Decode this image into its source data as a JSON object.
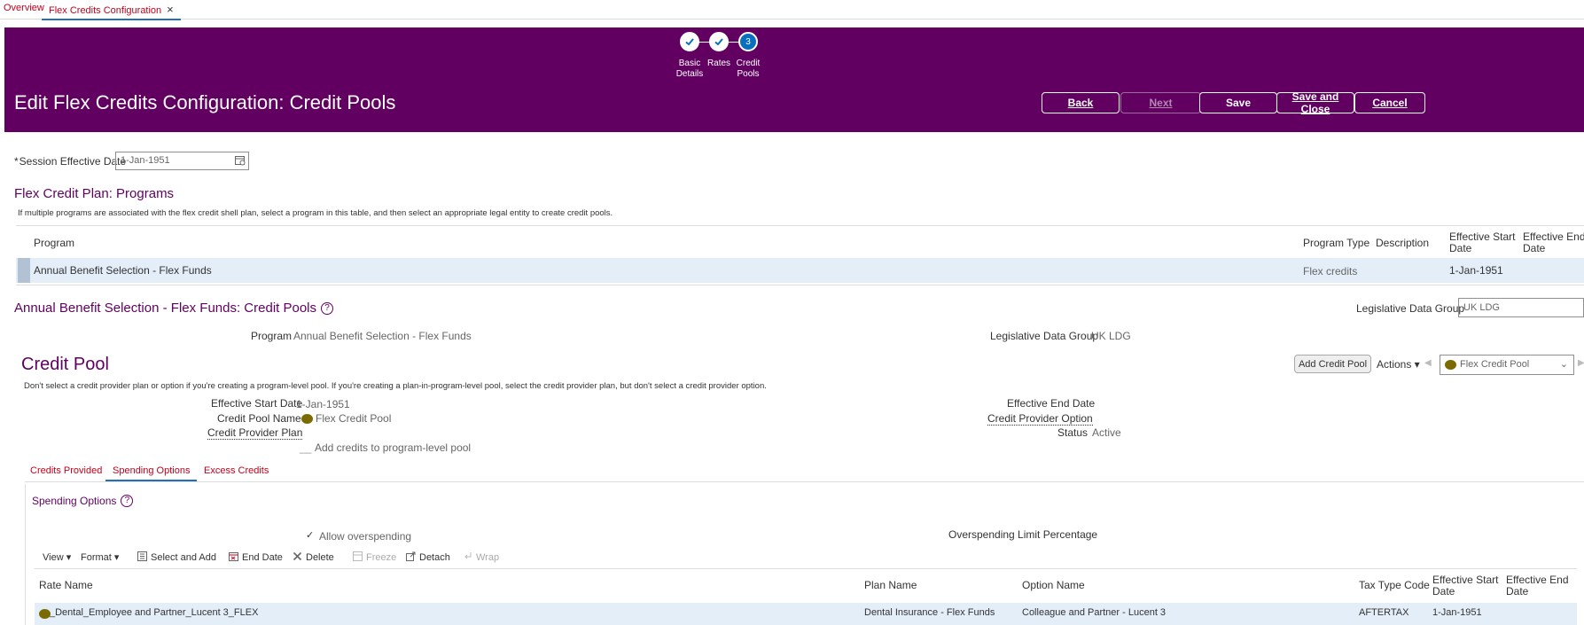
{
  "top_tabs": {
    "overview": "Overview",
    "flex": "Flex Credits Configuration",
    "close": "×"
  },
  "train": {
    "steps": [
      {
        "label": "Basic\nDetails",
        "state": "done"
      },
      {
        "label": "Rates",
        "state": "done"
      },
      {
        "label": "Credit\nPools",
        "state": "current",
        "number": "3"
      }
    ]
  },
  "header": {
    "title": "Edit Flex Credits Configuration: Credit Pools",
    "back": "Back",
    "next": "Next",
    "save": "Save",
    "save_close": "Save and Close",
    "cancel": "Cancel",
    "color": "#610061"
  },
  "session": {
    "required_mark": "*",
    "label": "Session Effective Date",
    "value": "1-Jan-1951"
  },
  "programs": {
    "title": "Flex Credit Plan: Programs",
    "instructions": "If multiple programs are associated with the flex credit shell plan, select a program in this table, and then select an appropriate legal entity to create credit pools.",
    "columns": {
      "program": "Program",
      "type": "Program Type",
      "desc": "Description",
      "start": "Effective Start Date",
      "end": "Effective End Date"
    },
    "row": {
      "program": "Annual Benefit Selection - Flex Funds",
      "type": "Flex credits",
      "desc": "",
      "start": "1-Jan-1951",
      "end": ""
    }
  },
  "pools": {
    "title": "Annual Benefit Selection - Flex Funds: Credit Pools",
    "help": "?",
    "ldg_label": "Legislative Data Group",
    "ldg_value": "UK LDG",
    "program_label": "Program",
    "program_value": "Annual Benefit Selection - Flex Funds",
    "ldg_label2": "Legislative Data Group",
    "ldg_value2": "UK LDG"
  },
  "credit_pool": {
    "title": "Credit Pool",
    "add_button": "Add Credit Pool",
    "actions": "Actions ▾",
    "selected": "Flex Credit Pool",
    "instructions": "Don't select a credit provider plan or option if you're creating a program-level pool. If you're creating a plan-in-program-level pool, select the credit provider plan, but don't select a credit provider option.",
    "start_label": "Effective Start Date",
    "start_value": "1-Jan-1951",
    "name_label": "Credit Pool Name",
    "name_value": "Flex Credit Pool",
    "provider_plan_label": "Credit Provider Plan",
    "add_credits": "Add credits to program-level pool",
    "end_label": "Effective End Date",
    "end_value": "",
    "provider_option_label": "Credit Provider Option",
    "status_label": "Status",
    "status_value": "Active"
  },
  "subtabs": {
    "provided": "Credits Provided",
    "spending": "Spending Options",
    "excess": "Excess Credits"
  },
  "spending": {
    "title": "Spending Options",
    "help": "?",
    "allow_check": "✓",
    "allow_label": "Allow overspending",
    "limit_label": "Overspending Limit Percentage",
    "toolbar": {
      "view": "View ▾",
      "format": "Format ▾",
      "select_add": "Select and Add",
      "end_date": "End Date",
      "delete": "Delete",
      "freeze": "Freeze",
      "detach": "Detach",
      "wrap": "Wrap"
    },
    "columns": {
      "rate": "Rate Name",
      "plan": "Plan Name",
      "option": "Option Name",
      "tax": "Tax Type Code",
      "start": "Effective Start Date",
      "end": "Effective End Date"
    },
    "row": {
      "rate": "_Dental_Employee and Partner_Lucent 3_FLEX",
      "plan": "Dental Insurance - Flex Funds",
      "option": "Colleague and Partner - Lucent 3",
      "tax": "AFTERTAX",
      "start": "1-Jan-1951",
      "end": ""
    }
  }
}
